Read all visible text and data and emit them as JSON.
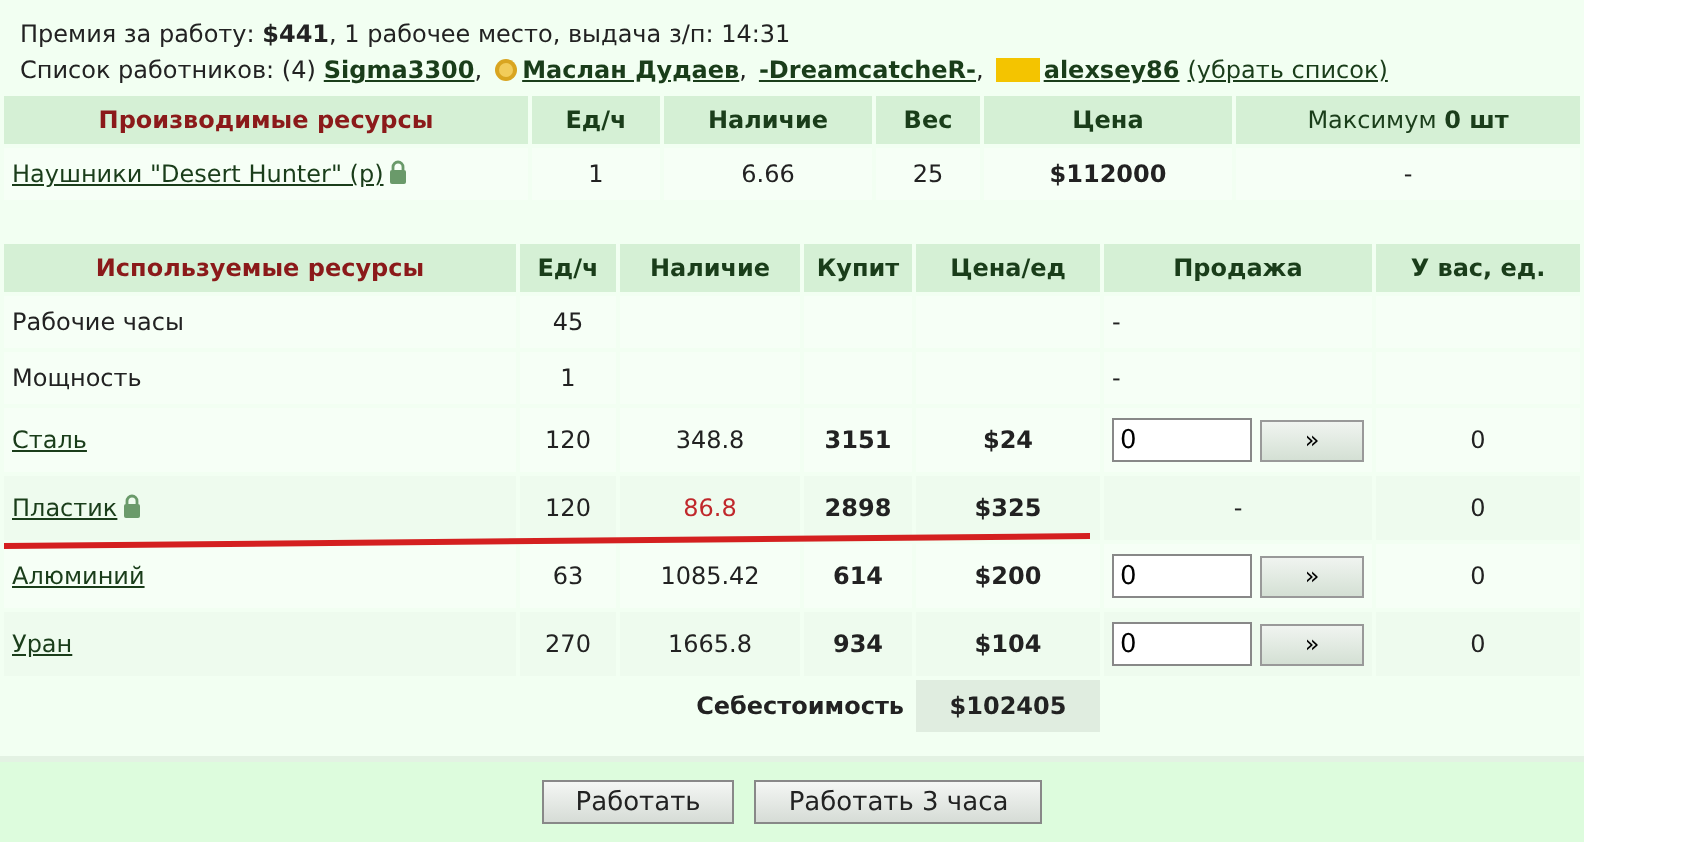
{
  "bonus": "Премия за работу: **$441**, 1 рабочее место, выдача з/п: 14:31",
  "workers": {
    "label": "Список работников: (4)",
    "items": [
      {
        "name": "Sigma3300",
        "kind": "plain",
        "suffix": ","
      },
      {
        "name": "Маслан Дудаев",
        "kind": "coin",
        "suffix": ","
      },
      {
        "name": "-DreamcatcheR-",
        "kind": "plain",
        "suffix": ","
      },
      {
        "name": "alexsey86",
        "kind": "hidden"
      }
    ],
    "hide_link": "(убрать список)"
  },
  "produced": {
    "columns": [
      "Производимые ресурсы",
      "Ед/ч",
      "Наличие",
      "Вес",
      "Цена",
      "Максимум **0 шт**"
    ],
    "rows": [
      {
        "name": "Наушники \"Desert Hunter\" (р)",
        "locked": true,
        "per_hour": "1",
        "stock": "6.66",
        "weight": "25",
        "price": "$112000",
        "max": "-"
      }
    ]
  },
  "used": {
    "columns": [
      "Используемые ресурсы",
      "Ед/ч",
      "Наличие",
      "Купит",
      "Цена/ед",
      "Продажа",
      "У вас, ед."
    ],
    "rows": [
      {
        "kind": "stat",
        "name": "Рабочие часы",
        "per_hour": "45",
        "sale": {
          "kind": "dash",
          "text": "-"
        }
      },
      {
        "kind": "stat",
        "name": "Мощность",
        "per_hour": "1",
        "sale": {
          "kind": "dash",
          "text": "-"
        }
      },
      {
        "kind": "material",
        "name": "Сталь",
        "locked": false,
        "per_hour": "120",
        "stock": "348.8",
        "low": false,
        "buy": "3151",
        "price": "$24",
        "sale": {
          "kind": "input",
          "value": "0",
          "button": "»"
        },
        "owned": "0"
      },
      {
        "kind": "material",
        "name": "Пластик",
        "locked": true,
        "per_hour": "120",
        "stock": "86.8",
        "low": true,
        "buy": "2898",
        "price": "$325",
        "sale": {
          "kind": "dash",
          "text": "-"
        },
        "owned": "0"
      },
      {
        "kind": "material",
        "name": "Алюминий",
        "locked": false,
        "per_hour": "63",
        "stock": "1085.42",
        "low": false,
        "buy": "614",
        "price": "$200",
        "sale": {
          "kind": "input",
          "value": "0",
          "button": "»"
        },
        "owned": "0"
      },
      {
        "kind": "material",
        "name": "Уран",
        "locked": false,
        "per_hour": "270",
        "stock": "1665.8",
        "low": false,
        "buy": "934",
        "price": "$104",
        "sale": {
          "kind": "input",
          "value": "0",
          "button": "»"
        },
        "owned": "0"
      }
    ],
    "summary": {
      "label": "Себестоимость",
      "value": "$102405"
    }
  },
  "buttons": [
    "Работать",
    "Работать 3 часа"
  ]
}
